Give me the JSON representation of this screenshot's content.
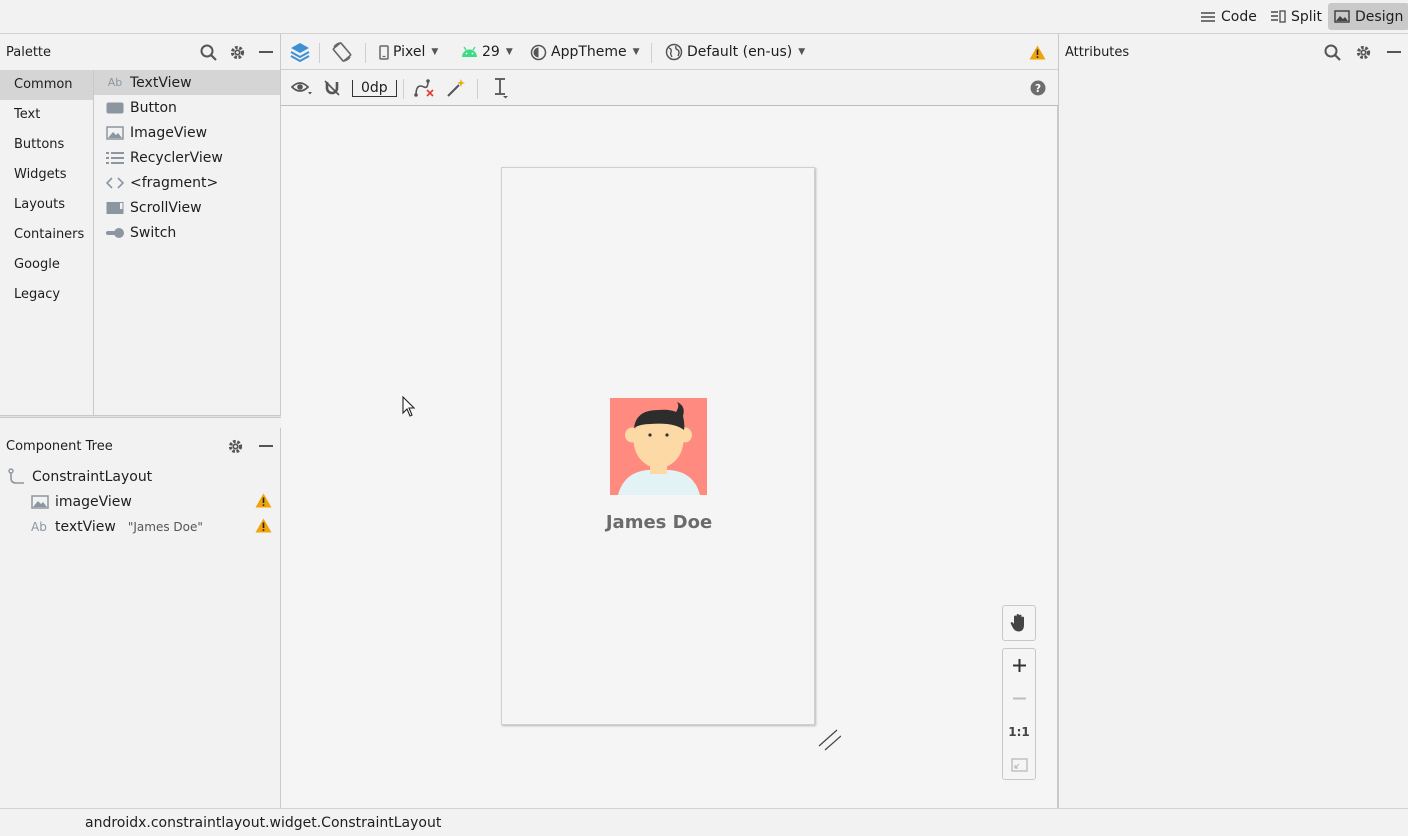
{
  "modes": {
    "code_label": "Code",
    "split_label": "Split",
    "design_label": "Design",
    "active": "Design"
  },
  "palette": {
    "title": "Palette",
    "categories": [
      "Common",
      "Text",
      "Buttons",
      "Widgets",
      "Layouts",
      "Containers",
      "Google",
      "Legacy"
    ],
    "selected_category": "Common",
    "widgets": [
      {
        "icon": "textview-icon",
        "label": "TextView"
      },
      {
        "icon": "button-icon",
        "label": "Button"
      },
      {
        "icon": "imageview-icon",
        "label": "ImageView"
      },
      {
        "icon": "recyclerview-icon",
        "label": "RecyclerView"
      },
      {
        "icon": "fragment-icon",
        "label": "<fragment>"
      },
      {
        "icon": "scrollview-icon",
        "label": "ScrollView"
      },
      {
        "icon": "switch-icon",
        "label": "Switch"
      }
    ],
    "selected_widget": "TextView"
  },
  "component_tree": {
    "title": "Component Tree",
    "root": "ConstraintLayout",
    "children": [
      {
        "label": "imageView",
        "detail": "",
        "warning": true
      },
      {
        "label": "textView",
        "detail": "\"James Doe\"",
        "warning": true
      }
    ]
  },
  "toolbar": {
    "device": "Pixel",
    "api_level": "29",
    "theme": "AppTheme",
    "locale": "Default (en-us)",
    "margin": "0dp"
  },
  "canvas": {
    "name_text": "James Doe",
    "zoom_one_to_one": "1:1"
  },
  "attributes": {
    "title": "Attributes"
  },
  "status": {
    "text": "androidx.constraintlayout.widget.ConstraintLayout"
  },
  "colors": {
    "accent": "#3d8fd6",
    "warning": "#f0a30a",
    "android_green": "#3ddc84",
    "avatar_bg": "#ff8a80"
  }
}
